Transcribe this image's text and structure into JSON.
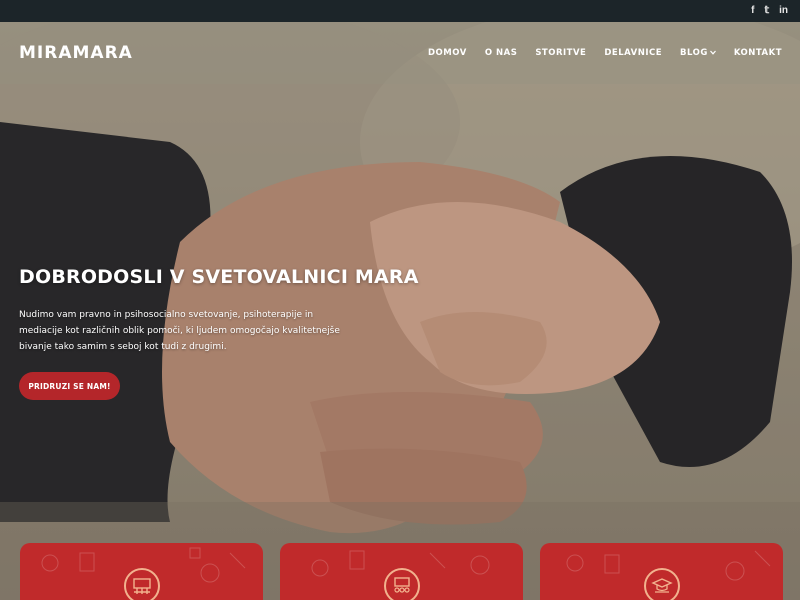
{
  "topbar": {
    "social": [
      {
        "icon": "facebook-icon",
        "glyph": "f"
      },
      {
        "icon": "twitter-icon",
        "glyph": "𝕥"
      },
      {
        "icon": "linkedin-icon",
        "glyph": "in"
      }
    ]
  },
  "header": {
    "logo": "MIRAMARA",
    "nav": [
      {
        "label": "DOMOV"
      },
      {
        "label": "O NAS"
      },
      {
        "label": "STORITVE"
      },
      {
        "label": "DELAVNICE"
      },
      {
        "label": "BLOG",
        "has_dropdown": true
      },
      {
        "label": "KONTAKT"
      }
    ]
  },
  "hero": {
    "title": "DOBRODOSLI V SVETOVALNICI MARA",
    "text": "Nudimo vam pravno in psihosocialno svetovanje, psihoterapije in mediacije kot različnih oblik pomoči, ki ljudem omogočajo kvalitetnejše bivanje tako samim s seboj kot tudi z drugimi.",
    "cta": "PRIDRUZI SE NAM!"
  },
  "cards": [
    {
      "icon": "building-icon"
    },
    {
      "icon": "classroom-icon"
    },
    {
      "icon": "graduation-icon"
    }
  ],
  "colors": {
    "accent": "#b4262a",
    "card": "#c02a2b",
    "topbar": "#1c2529"
  }
}
